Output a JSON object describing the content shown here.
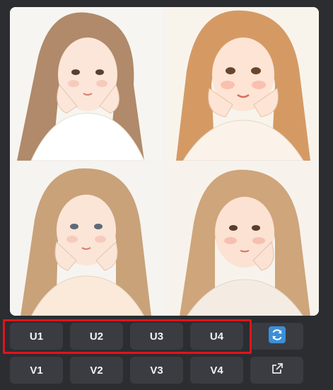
{
  "upscale_row": [
    {
      "label": "U1",
      "name": "upscale-1-button"
    },
    {
      "label": "U2",
      "name": "upscale-2-button"
    },
    {
      "label": "U3",
      "name": "upscale-3-button"
    },
    {
      "label": "U4",
      "name": "upscale-4-button"
    }
  ],
  "variation_row": [
    {
      "label": "V1",
      "name": "variation-1-button"
    },
    {
      "label": "V2",
      "name": "variation-2-button"
    },
    {
      "label": "V3",
      "name": "variation-3-button"
    },
    {
      "label": "V4",
      "name": "variation-4-button"
    }
  ],
  "icons": {
    "reroll": "reroll-icon",
    "open_external": "open-external-icon"
  },
  "colors": {
    "background": "#2b2d31",
    "button": "#3a3c42",
    "button_text": "#f2f3f5",
    "reroll_accent": "#3b8fd8",
    "highlight": "#e0141b"
  }
}
